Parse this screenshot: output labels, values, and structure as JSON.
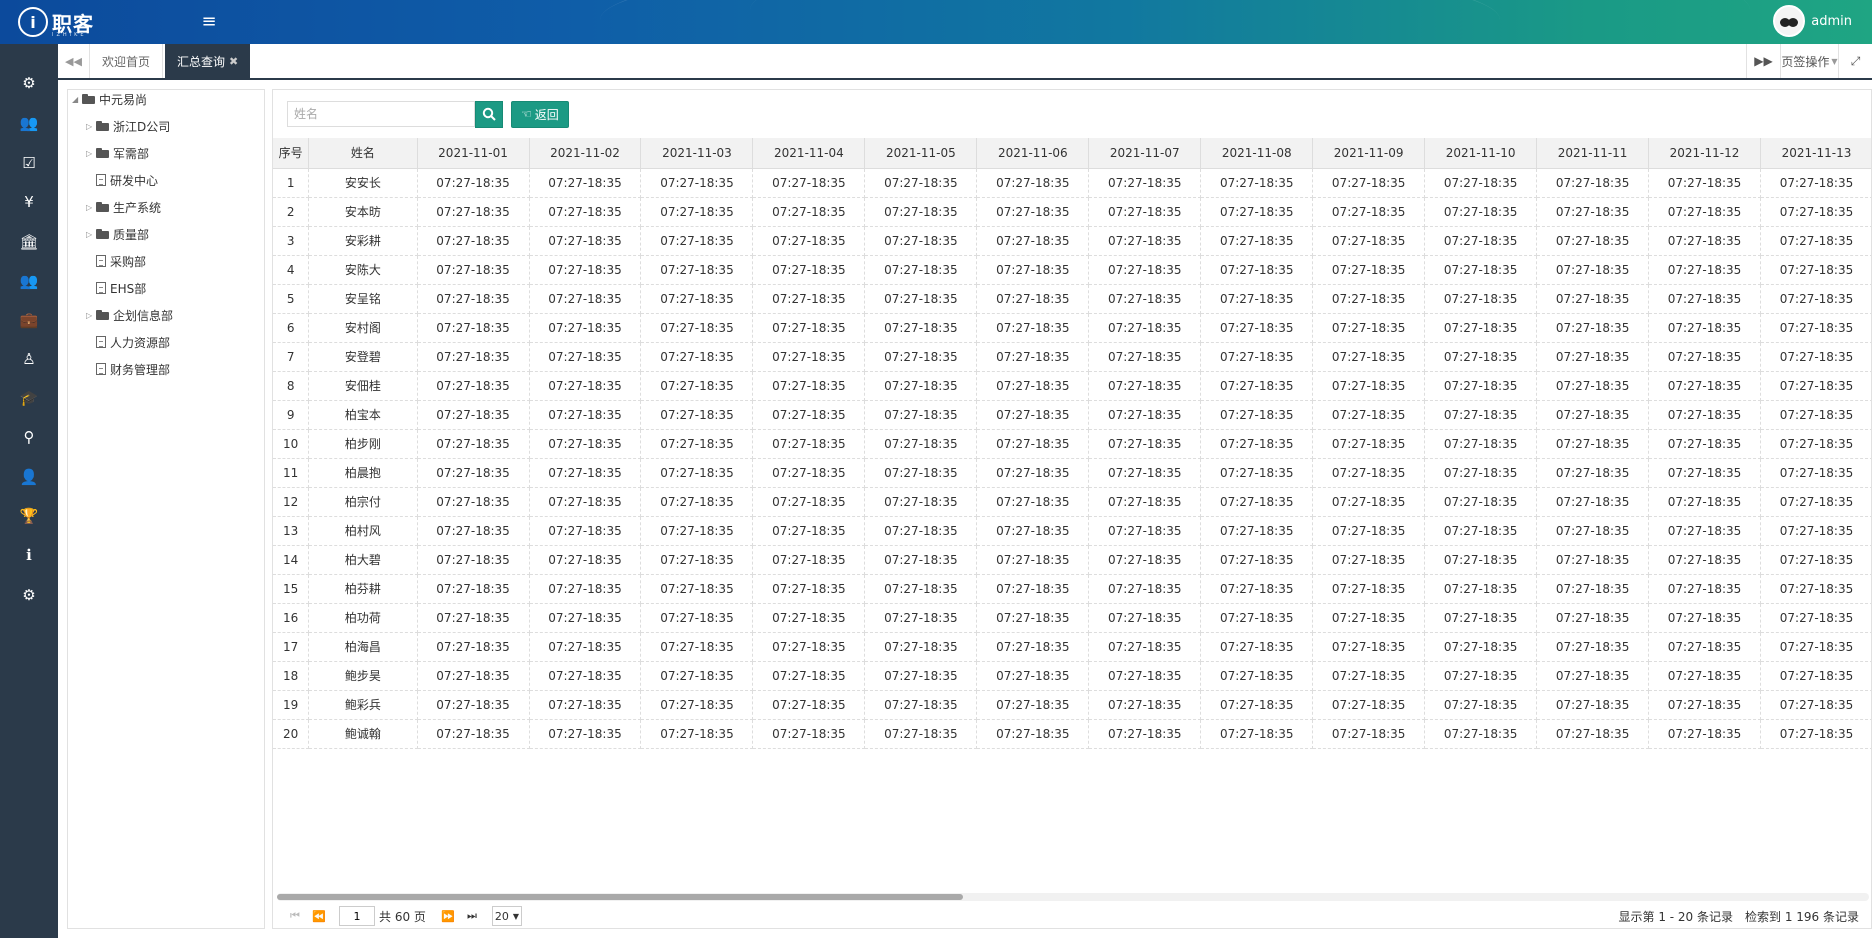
{
  "header": {
    "logo_text": "职客",
    "logo_sub": "IZHIKE",
    "user_name": "admin"
  },
  "sidebar_icons": [
    "dashboard-icon",
    "users-icon",
    "checkbox-icon",
    "yen-icon",
    "bank-icon",
    "group-icon",
    "briefcase-icon",
    "user-tie-icon",
    "graduation-cap-icon",
    "award-icon",
    "user-icon",
    "trophy-icon",
    "info-icon",
    "cogs-icon"
  ],
  "tabs": {
    "home": "欢迎首页",
    "active": "汇总查询",
    "page_ops": "页签操作"
  },
  "tree": {
    "root": "中元易尚",
    "items": [
      {
        "label": "浙江D公司",
        "type": "folder"
      },
      {
        "label": "军需部",
        "type": "folder"
      },
      {
        "label": "研发中心",
        "type": "file"
      },
      {
        "label": "生产系统",
        "type": "folder"
      },
      {
        "label": "质量部",
        "type": "folder"
      },
      {
        "label": "采购部",
        "type": "file"
      },
      {
        "label": "EHS部",
        "type": "file"
      },
      {
        "label": "企划信息部",
        "type": "folder"
      },
      {
        "label": "人力资源部",
        "type": "file"
      },
      {
        "label": "财务管理部",
        "type": "file"
      }
    ]
  },
  "search": {
    "placeholder": "姓名",
    "back_label": "返回"
  },
  "table": {
    "columns": [
      "序号",
      "姓名",
      "2021-11-01",
      "2021-11-02",
      "2021-11-03",
      "2021-11-04",
      "2021-11-05",
      "2021-11-06",
      "2021-11-07",
      "2021-11-08",
      "2021-11-09",
      "2021-11-10",
      "2021-11-11",
      "2021-11-12",
      "2021-11-13"
    ],
    "cell_value": "07:27-18:35",
    "rows": [
      {
        "idx": "1",
        "name": "安安长"
      },
      {
        "idx": "2",
        "name": "安本昉"
      },
      {
        "idx": "3",
        "name": "安彩耕"
      },
      {
        "idx": "4",
        "name": "安陈大"
      },
      {
        "idx": "5",
        "name": "安呈铭"
      },
      {
        "idx": "6",
        "name": "安村阁"
      },
      {
        "idx": "7",
        "name": "安登碧"
      },
      {
        "idx": "8",
        "name": "安佃桂"
      },
      {
        "idx": "9",
        "name": "柏宝本"
      },
      {
        "idx": "10",
        "name": "柏步刚"
      },
      {
        "idx": "11",
        "name": "柏晨抱"
      },
      {
        "idx": "12",
        "name": "柏宗付"
      },
      {
        "idx": "13",
        "name": "柏村风"
      },
      {
        "idx": "14",
        "name": "柏大碧"
      },
      {
        "idx": "15",
        "name": "柏芬耕"
      },
      {
        "idx": "16",
        "name": "柏功荷"
      },
      {
        "idx": "17",
        "name": "柏海昌"
      },
      {
        "idx": "18",
        "name": "鲍步昊"
      },
      {
        "idx": "19",
        "name": "鲍彩兵"
      },
      {
        "idx": "20",
        "name": "鲍诚翰"
      }
    ]
  },
  "pager": {
    "current_page": "1",
    "total_pages": "共 60 页",
    "page_size": "20",
    "range_text": "显示第 1 - 20 条记录",
    "total_text": "检索到 1 196 条记录"
  },
  "colors": {
    "accent": "#1c9a84",
    "sidebar": "#2b3a4a"
  }
}
